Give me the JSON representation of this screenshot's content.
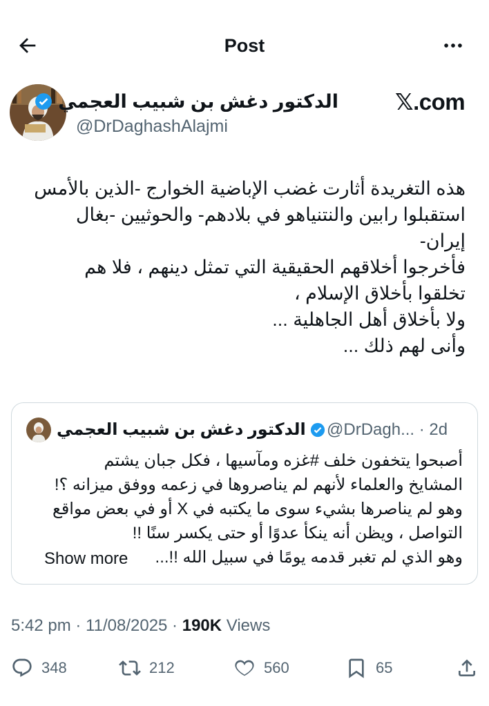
{
  "header": {
    "title": "Post"
  },
  "author": {
    "name": "الدكتور دغش بن شبيب العجمي",
    "handle": "@DrDaghashAlajmi",
    "source": "𝕏.com"
  },
  "tweet": {
    "lines": [
      "هذه التغريدة أثارت غضب الإباضية الخوارج -الذين بالأمس",
      "استقبلوا رابين والنتنياهو في بلادهم- والحوثيين -بغال",
      "إيران-",
      "فأخرجوا أخلاقهم الحقيقية التي تمثل دينهم ، فلا هم",
      "تخلقوا بأخلاق الإسلام ،",
      "ولا بأخلاق أهل الجاهلية ...",
      "وأنى لهم ذلك ..."
    ]
  },
  "quote": {
    "name": "الدكتور دغش بن شبيب العجمي",
    "meta": "@DrDagh... · 2d",
    "lines": [
      "أصبحوا يتخفون خلف #غزه ومآسيها ، فكل جبان يشتم",
      "المشايخ والعلماء لأنهم لم يناصروها في زعمه ووفق ميزانه ؟!",
      "وهو لم يناصرها بشيء سوى ما يكتبه في X أو في بعض مواقع",
      "التواصل ، ويظن أنه ينكأ عدوًا أو حتى يكسر سنًا !!",
      "وهو الذي لم تغبر قدمه يومًا في سبيل الله !!..."
    ],
    "show_more": "Show more"
  },
  "meta": {
    "time": "5:42 pm · 11/08/2025 ·",
    "views_count": "190K",
    "views_label": "Views"
  },
  "actions": {
    "replies": "348",
    "reposts": "212",
    "likes": "560",
    "bookmarks": "65"
  },
  "colors": {
    "text": "#0f1419",
    "secondary": "#536471",
    "verified": "#1d9bf0",
    "border": "#cfd9de"
  }
}
